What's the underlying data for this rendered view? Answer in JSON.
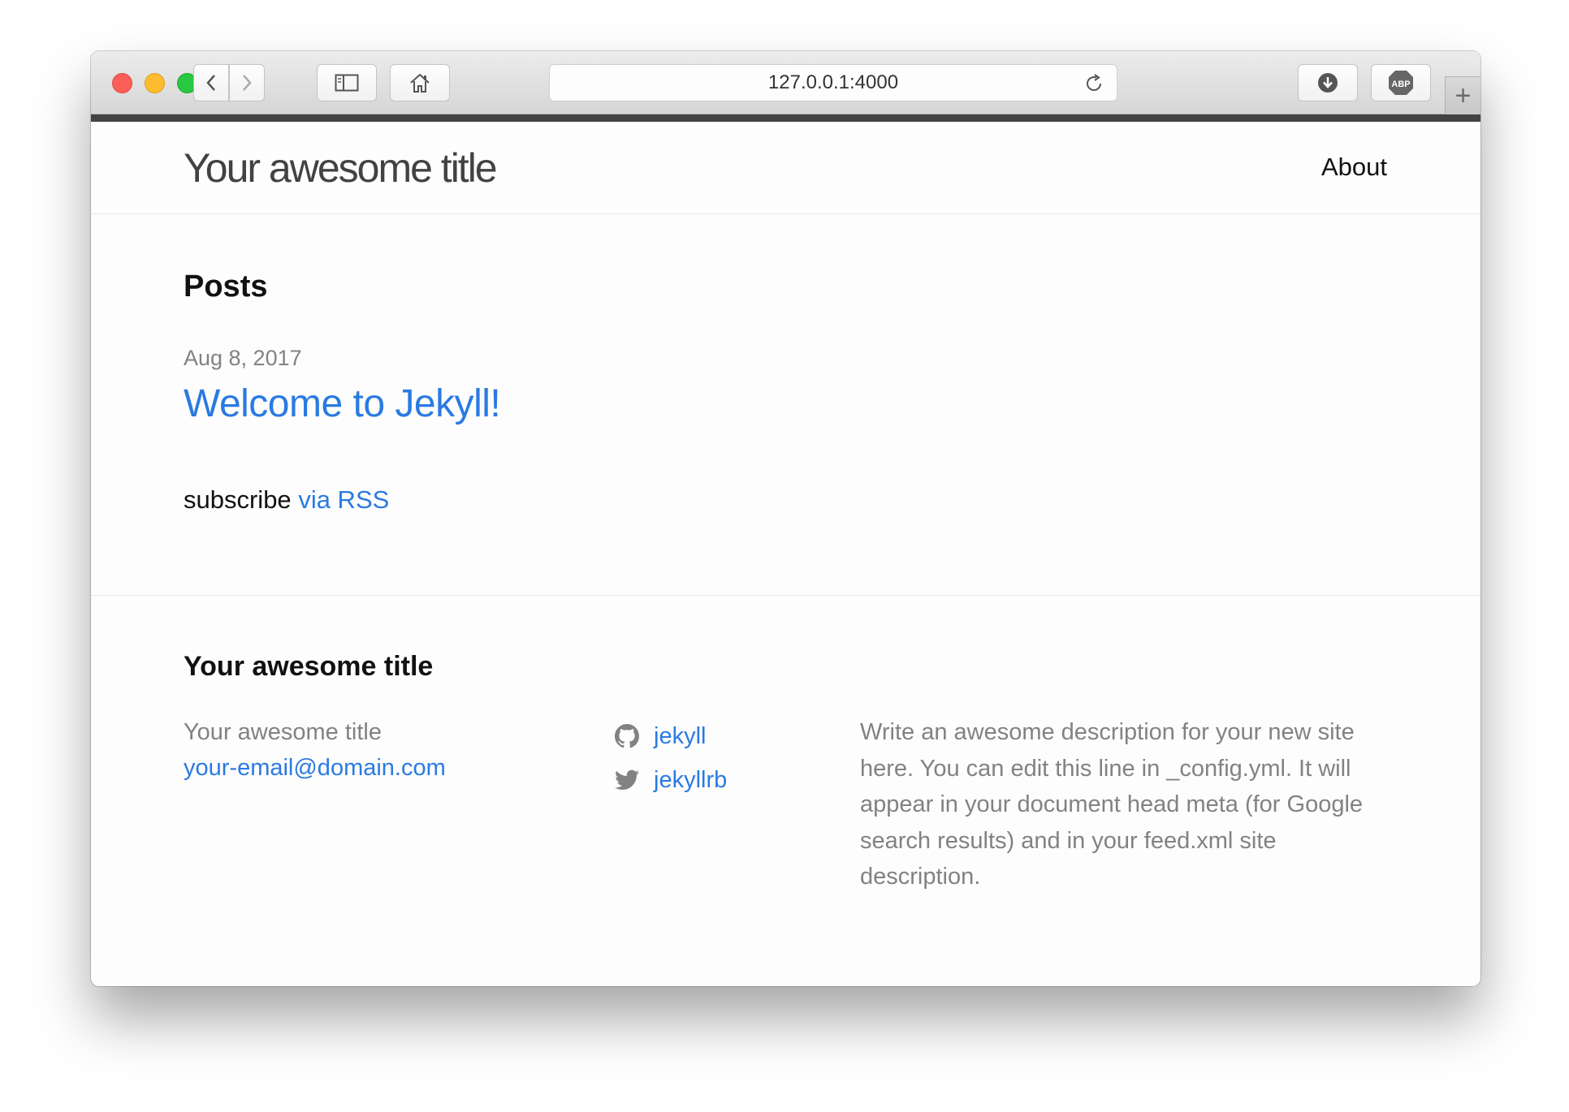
{
  "browser": {
    "url": "127.0.0.1:4000",
    "newtab_label": "+",
    "adblock_label": "ABP"
  },
  "header": {
    "site_title": "Your awesome title",
    "nav": [
      {
        "label": "About"
      }
    ]
  },
  "main": {
    "posts_heading": "Posts",
    "posts": [
      {
        "date": "Aug 8, 2017",
        "title": "Welcome to Jekyll!"
      }
    ],
    "subscribe_text": "subscribe",
    "subscribe_link": "via RSS"
  },
  "footer": {
    "heading": "Your awesome title",
    "name": "Your awesome title",
    "email": "your-email@domain.com",
    "social": [
      {
        "icon": "github-icon",
        "label": "jekyll"
      },
      {
        "icon": "twitter-icon",
        "label": "jekyllrb"
      }
    ],
    "description": "Write an awesome description for your new site here. You can edit this line in _config.yml. It will appear in your document head meta (for Google search results) and in your feed.xml site description."
  },
  "colors": {
    "link": "#2a7ae2",
    "muted": "#828282",
    "accent_bar": "#424242"
  }
}
